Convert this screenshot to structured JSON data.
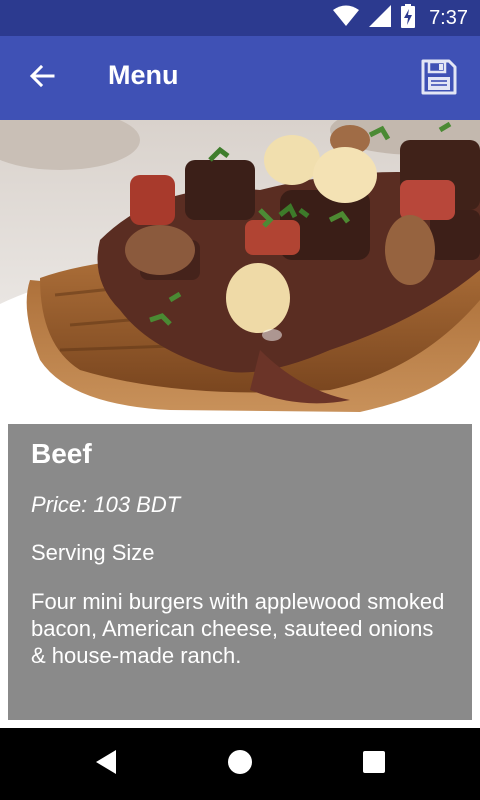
{
  "status_bar": {
    "time": "7:37",
    "icons": [
      "wifi-icon",
      "cell-signal-icon",
      "battery-charging-icon"
    ],
    "color": "#2c3a8f"
  },
  "app_bar": {
    "title": "Menu",
    "back_icon": "arrow-back-icon",
    "save_icon": "floppy-disk-icon",
    "color": "#3f51b5"
  },
  "item": {
    "name": "Beef",
    "price": "Price: 103 BDT",
    "serving_size": "Serving Size",
    "description": "Four mini burgers with applewood smoked bacon, American cheese, sauteed onions & house-made ranch.",
    "card_color": "#8a8a8a"
  },
  "nav_bar": {
    "icons": [
      "back-triangle-icon",
      "home-circle-icon",
      "recents-square-icon"
    ]
  }
}
